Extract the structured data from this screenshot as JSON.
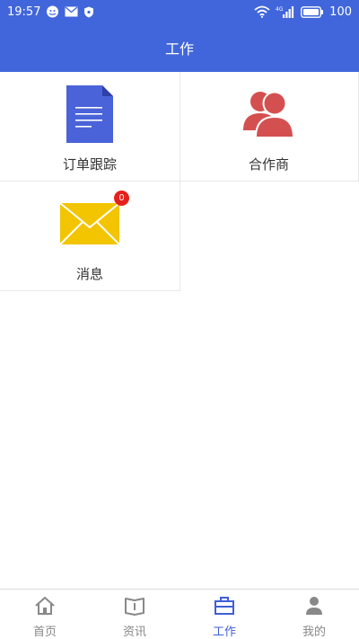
{
  "status_bar": {
    "time": "19:57",
    "battery": "100",
    "network": "4G",
    "icons": [
      "wechat-icon",
      "mail-icon",
      "shield-icon",
      "wifi-icon",
      "signal-icon",
      "battery-icon"
    ]
  },
  "header": {
    "title": "工作"
  },
  "grid": {
    "items": [
      {
        "label": "订单跟踪",
        "icon": "document-icon"
      },
      {
        "label": "合作商",
        "icon": "people-icon"
      },
      {
        "label": "消息",
        "icon": "envelope-icon",
        "badge": "0"
      }
    ]
  },
  "tabbar": {
    "items": [
      {
        "label": "首页",
        "icon": "home-icon",
        "active": false
      },
      {
        "label": "资讯",
        "icon": "book-icon",
        "active": false
      },
      {
        "label": "工作",
        "icon": "briefcase-icon",
        "active": true
      },
      {
        "label": "我的",
        "icon": "user-icon",
        "active": false
      }
    ]
  },
  "colors": {
    "primary": "#4166db",
    "document": "#4a63d9",
    "people": "#d45050",
    "envelope": "#f2c500",
    "badge": "#e5211c",
    "tab_active": "#3f5fd6",
    "tab_inactive": "#888888"
  }
}
